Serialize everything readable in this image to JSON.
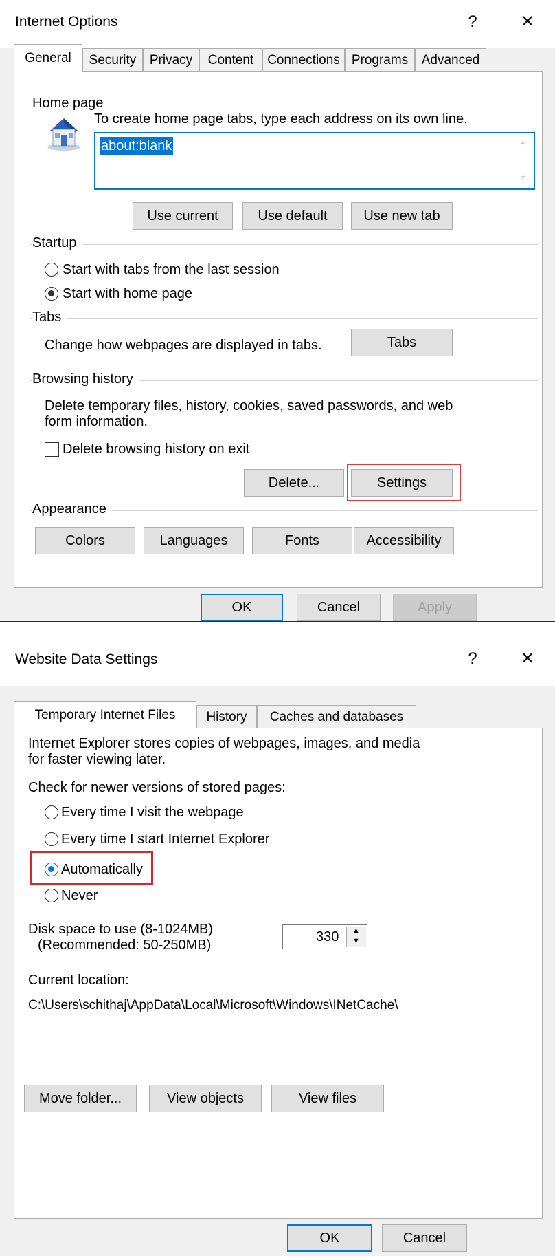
{
  "internet_options": {
    "title": "Internet Options",
    "help": "?",
    "close": "✕",
    "tabs": [
      "General",
      "Security",
      "Privacy",
      "Content",
      "Connections",
      "Programs",
      "Advanced"
    ],
    "home_page": {
      "label": "Home page",
      "instruction": "To create home page tabs, type each address on its own line.",
      "value": "about:blank",
      "buttons": [
        "Use current",
        "Use default",
        "Use new tab"
      ]
    },
    "startup": {
      "label": "Startup",
      "options": [
        "Start with tabs from the last session",
        "Start with home page"
      ],
      "selected": 1
    },
    "tabs_group": {
      "label": "Tabs",
      "description": "Change how webpages are displayed in tabs.",
      "button": "Tabs"
    },
    "browsing_history": {
      "label": "Browsing history",
      "description_line1": "Delete temporary files, history, cookies, saved passwords, and web",
      "description_line2": "form information.",
      "checkbox": "Delete browsing history on exit",
      "checked": false,
      "delete_button": "Delete...",
      "settings_button": "Settings"
    },
    "appearance": {
      "label": "Appearance",
      "buttons": [
        "Colors",
        "Languages",
        "Fonts",
        "Accessibility"
      ]
    },
    "footer": {
      "ok": "OK",
      "cancel": "Cancel",
      "apply": "Apply"
    },
    "highlight_color": "#e53935"
  },
  "website_data_settings": {
    "title": "Website Data Settings",
    "help": "?",
    "close": "✕",
    "tabs": [
      "Temporary Internet Files",
      "History",
      "Caches and databases"
    ],
    "description_line1": "Internet Explorer stores copies of webpages, images, and media",
    "description_line2": "for faster viewing later.",
    "check_label": "Check for newer versions of stored pages:",
    "options": [
      "Every time I visit the webpage",
      "Every time I start Internet Explorer",
      "Automatically",
      "Never"
    ],
    "selected": 2,
    "disk_label_line1": "Disk space to use (8-1024MB)",
    "disk_label_line2": "(Recommended: 50-250MB)",
    "disk_value": "330",
    "location_label": "Current location:",
    "location_path": "C:\\Users\\schithaj\\AppData\\Local\\Microsoft\\Windows\\INetCache\\",
    "buttons": [
      "Move folder...",
      "View objects",
      "View files"
    ],
    "footer": {
      "ok": "OK",
      "cancel": "Cancel"
    },
    "highlight_color": "#e0202e"
  }
}
